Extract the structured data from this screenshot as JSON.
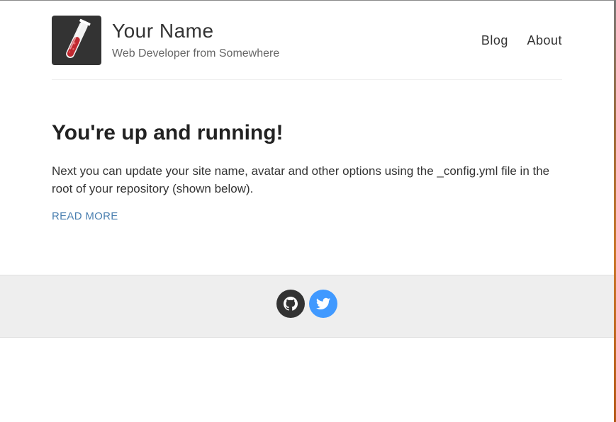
{
  "header": {
    "site_title": "Your Name",
    "site_description": "Web Developer from Somewhere",
    "avatar_icon": "test-tube-icon",
    "nav": [
      {
        "label": "Blog"
      },
      {
        "label": "About"
      }
    ]
  },
  "post": {
    "title": "You're up and running!",
    "excerpt": "Next you can update your site name, avatar and other options using the _config.yml file in the root of your repository (shown below).",
    "read_more_label": "READ MORE"
  },
  "footer": {
    "social": [
      {
        "icon": "github-icon",
        "color": "#333333"
      },
      {
        "icon": "twitter-icon",
        "color": "#4099ff"
      }
    ]
  },
  "colors": {
    "link": "#4a7fb0",
    "footer_bg": "#eeeeee",
    "avatar_bg": "#333333"
  }
}
